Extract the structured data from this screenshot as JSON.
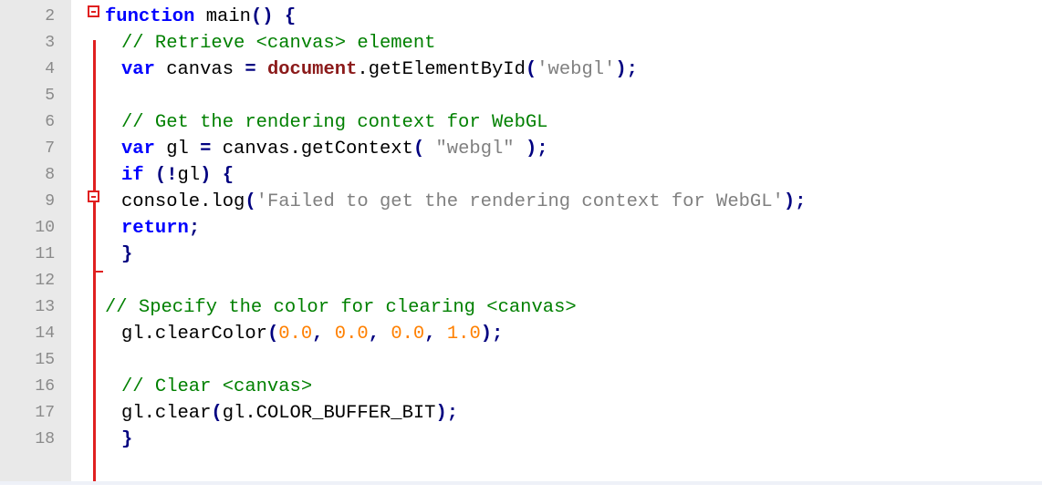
{
  "editor": {
    "fold_markers": [
      "fold-open",
      "fold-open",
      "fold-close"
    ],
    "lines": [
      {
        "num": "2",
        "indent": 1,
        "tokens": [
          [
            "kw",
            "function"
          ],
          [
            "txt",
            " main"
          ],
          [
            "pun",
            "()"
          ],
          [
            "txt",
            " "
          ],
          [
            "pun",
            "{"
          ]
        ]
      },
      {
        "num": "3",
        "indent": 2,
        "tokens": [
          [
            "cmt",
            "// Retrieve <canvas> element"
          ]
        ]
      },
      {
        "num": "4",
        "indent": 2,
        "tokens": [
          [
            "kw",
            "var"
          ],
          [
            "txt",
            " canvas "
          ],
          [
            "pun",
            "="
          ],
          [
            "txt",
            " "
          ],
          [
            "obj",
            "document"
          ],
          [
            "txt",
            "."
          ],
          [
            "txt",
            "getElementById"
          ],
          [
            "pun",
            "("
          ],
          [
            "str",
            "'webgl'"
          ],
          [
            "pun",
            ");"
          ]
        ]
      },
      {
        "num": "5",
        "indent": 2,
        "tokens": []
      },
      {
        "num": "6",
        "indent": 2,
        "tokens": [
          [
            "cmt",
            "// Get the rendering context for WebGL"
          ]
        ]
      },
      {
        "num": "7",
        "indent": 2,
        "tokens": [
          [
            "kw",
            "var"
          ],
          [
            "txt",
            " gl "
          ],
          [
            "pun",
            "="
          ],
          [
            "txt",
            " canvas.getContext"
          ],
          [
            "pun",
            "("
          ],
          [
            "txt",
            " "
          ],
          [
            "str",
            "\"webgl\""
          ],
          [
            "txt",
            " "
          ],
          [
            "pun",
            ");"
          ]
        ]
      },
      {
        "num": "8",
        "indent": 2,
        "tokens": [
          [
            "kw",
            "if"
          ],
          [
            "txt",
            " "
          ],
          [
            "pun",
            "(!"
          ],
          [
            "txt",
            "gl"
          ],
          [
            "pun",
            ")"
          ],
          [
            "txt",
            " "
          ],
          [
            "pun",
            "{"
          ]
        ]
      },
      {
        "num": "9",
        "indent": 2,
        "tokens": [
          [
            "txt",
            "console.log"
          ],
          [
            "pun",
            "("
          ],
          [
            "str",
            "'Failed to get the rendering context for WebGL'"
          ],
          [
            "pun",
            ");"
          ]
        ]
      },
      {
        "num": "10",
        "indent": 2,
        "tokens": [
          [
            "kw",
            "return"
          ],
          [
            "pun",
            ";"
          ]
        ]
      },
      {
        "num": "11",
        "indent": 2,
        "tokens": [
          [
            "pun",
            "}"
          ]
        ]
      },
      {
        "num": "12",
        "indent": 2,
        "tokens": []
      },
      {
        "num": "13",
        "indent": 1,
        "tokens": [
          [
            "cmt",
            "// Specify the color for clearing <canvas>"
          ]
        ]
      },
      {
        "num": "14",
        "indent": 2,
        "tokens": [
          [
            "txt",
            "gl.clearColor"
          ],
          [
            "pun",
            "("
          ],
          [
            "num",
            "0.0"
          ],
          [
            "pun",
            ","
          ],
          [
            "txt",
            " "
          ],
          [
            "num",
            "0.0"
          ],
          [
            "pun",
            ","
          ],
          [
            "txt",
            " "
          ],
          [
            "num",
            "0.0"
          ],
          [
            "pun",
            ","
          ],
          [
            "txt",
            " "
          ],
          [
            "num",
            "1.0"
          ],
          [
            "pun",
            ");"
          ]
        ]
      },
      {
        "num": "15",
        "indent": 2,
        "tokens": []
      },
      {
        "num": "16",
        "indent": 2,
        "tokens": [
          [
            "cmt",
            "// Clear <canvas>"
          ]
        ]
      },
      {
        "num": "17",
        "indent": 2,
        "tokens": [
          [
            "txt",
            "gl.clear"
          ],
          [
            "pun",
            "("
          ],
          [
            "txt",
            "gl.COLOR_BUFFER_BIT"
          ],
          [
            "pun",
            ");"
          ]
        ]
      },
      {
        "num": "18",
        "indent": 2,
        "tokens": [
          [
            "pun",
            "}"
          ]
        ]
      }
    ]
  },
  "colors": {
    "keyword": "#0000ff",
    "comment": "#008000",
    "string": "#808080",
    "number": "#ff8000",
    "fold_marker": "#e02020",
    "gutter_bg": "#e9e9e9"
  }
}
